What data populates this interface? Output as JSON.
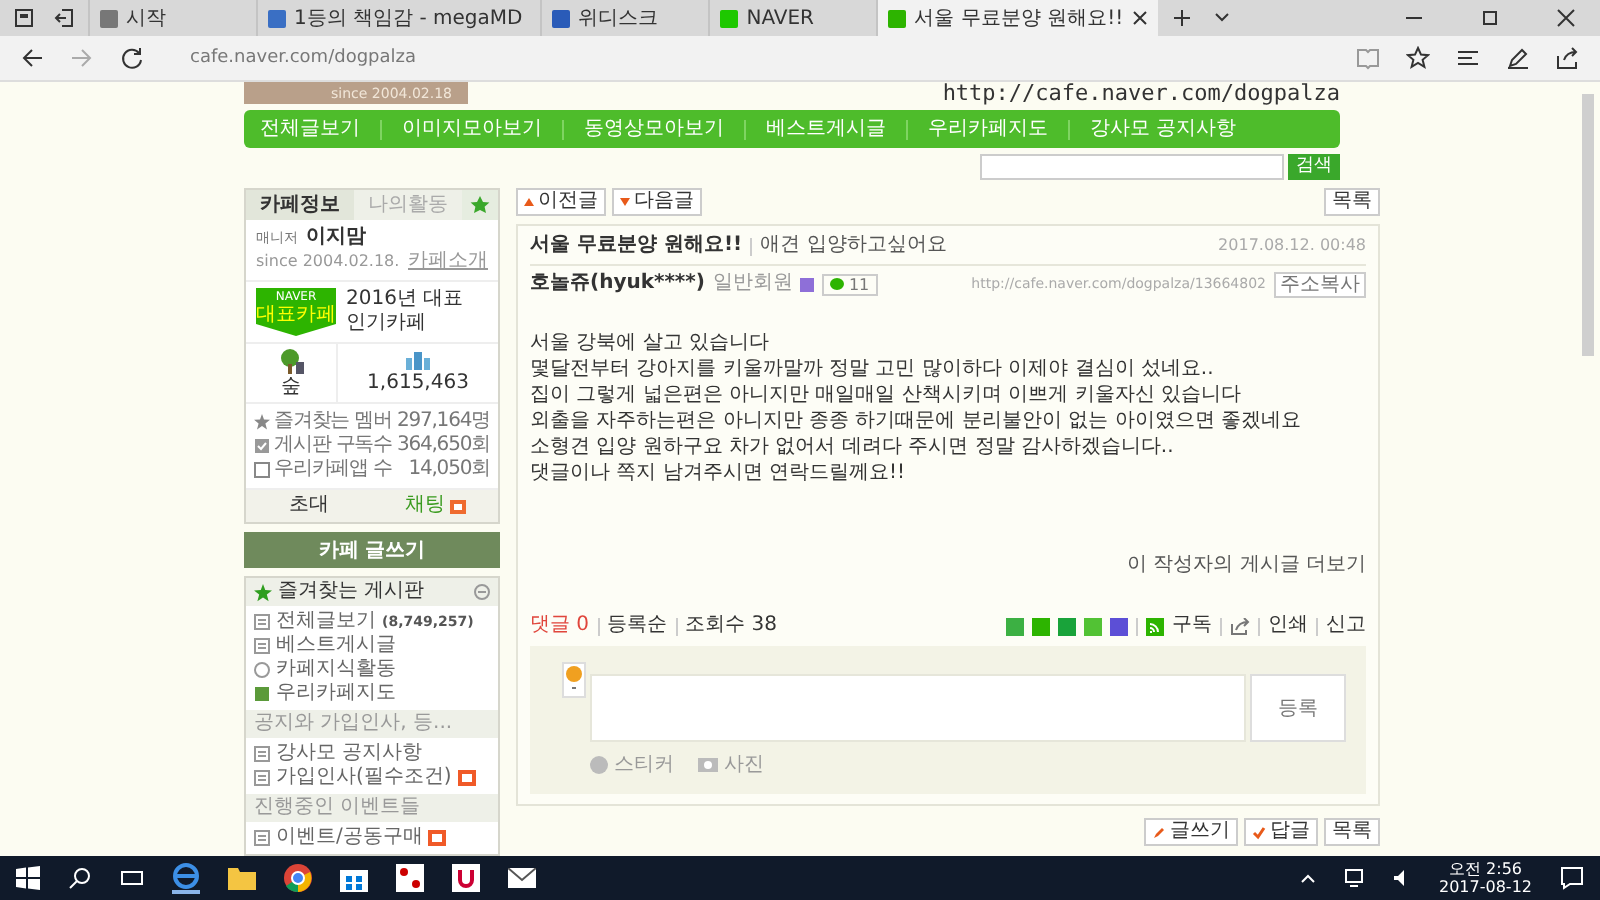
{
  "browser": {
    "tabs": [
      {
        "title": "시작",
        "selected": false,
        "color": "#777777"
      },
      {
        "title": "1등의 책임감 - megaMD",
        "selected": false,
        "color": "#3a6fc4"
      },
      {
        "title": "위디스크",
        "selected": false,
        "color": "#2a5bb8"
      },
      {
        "title": "NAVER",
        "selected": false,
        "color": "#1ec800"
      },
      {
        "title": "서울 무료분양 원해요!!",
        "selected": true,
        "color": "#2db400"
      }
    ],
    "address": "cafe.naver.com/dogpalza"
  },
  "banner": {
    "since": "since 2004.02.18",
    "url": "http://cafe.naver.com/dogpalza"
  },
  "nav": [
    "전체글보기",
    "이미지모아보기",
    "동영상모아보기",
    "베스트게시글",
    "우리카페지도",
    "강사모 공지사항"
  ],
  "search": {
    "button": "검색"
  },
  "sidebar": {
    "tabs": [
      {
        "label": "카페정보",
        "selected": true
      },
      {
        "label": "나의활동",
        "selected": false
      }
    ],
    "manager_label": "매니저",
    "manager": "이지맘",
    "since": "since 2004.02.18.",
    "about_link": "카페소개",
    "award": {
      "badge_top": "NAVER",
      "badge_bottom": "대표카페",
      "text": "2016년 대표 인기카페"
    },
    "level": "숲",
    "members": "1,615,463",
    "stats": [
      {
        "label": "즐겨찾는 멤버",
        "value": "297,164명",
        "kind": "star"
      },
      {
        "label": "게시판 구독수",
        "value": "364,650회",
        "kind": "check"
      },
      {
        "label": "우리카페앱 수",
        "value": "14,050회",
        "kind": "box"
      }
    ],
    "invite": "초대",
    "chat": "채팅",
    "write": "카페 글쓰기",
    "boards": [
      {
        "title": "즐겨찾는 게시판",
        "kind": "favorite",
        "items": [
          {
            "label": "전체글보기",
            "count": "(8,749,257)",
            "new": false,
            "kind": "list"
          },
          {
            "label": "베스트게시글",
            "new": false,
            "kind": "list"
          },
          {
            "label": "카페지식활동",
            "new": false,
            "kind": "round"
          },
          {
            "label": "우리카페지도",
            "new": false,
            "kind": "map"
          }
        ]
      },
      {
        "title": "공지와 가입인사, 등...",
        "kind": "group",
        "items": [
          {
            "label": "강사모 공지사항",
            "new": false,
            "kind": "list"
          },
          {
            "label": "가입인사(필수조건)",
            "new": true,
            "kind": "list"
          }
        ]
      },
      {
        "title": "진행중인 이벤트들",
        "kind": "group",
        "items": [
          {
            "label": "이벤트/공동구매",
            "new": true,
            "kind": "list"
          }
        ]
      }
    ]
  },
  "post": {
    "prev": "이전글",
    "next": "다음글",
    "list": "목록",
    "title": "서울 무료분양 원해요!!",
    "category": "애견 입양하고싶어요",
    "date": "2017.08.12. 00:48",
    "author": "호놀쥬(hyuk****)",
    "grade": "일반회원",
    "chat_count": "11",
    "permalink": "http://cafe.naver.com/dogpalza/13664802",
    "copy": "주소복사",
    "body": [
      "서울 강북에 살고 있습니다",
      "몇달전부터 강아지를 키울까말까 정말 고민 많이하다 이제야 결심이 섰네요..",
      "집이 그렇게 넓은편은 아니지만 매일매일 산책시키며 이쁘게 키울자신 있습니다",
      "외출을 자주하는편은 아니지만 종종 하기때문에 분리불안이 없는 아이였으면 좋겠네요",
      "소형견 입양 원하구요 차가 없어서 데려다 주시면 정말 감사하겠습니다..",
      "댓글이나 쪽지 남겨주시면 연락드릴께요!!"
    ],
    "more": "이 작성자의 게시글 더보기",
    "comments_label": "댓글",
    "comments_count": "0",
    "sort": "등록순",
    "views_label": "조회수",
    "views": "38",
    "share": [
      {
        "color": "#3cb043"
      },
      {
        "color": "#2db400"
      },
      {
        "color": "#19a33a"
      },
      {
        "color": "#52c234"
      },
      {
        "color": "#5c4fd6"
      }
    ],
    "subscribe": "구독",
    "print": "인쇄",
    "report": "신고",
    "submit": "등록",
    "sticker": "스티커",
    "photo": "사진",
    "write": "글쓰기",
    "reply": "답글",
    "list_bottom": "목록"
  },
  "taskbar": {
    "time": "오전 2:56",
    "date": "2017-08-12"
  }
}
